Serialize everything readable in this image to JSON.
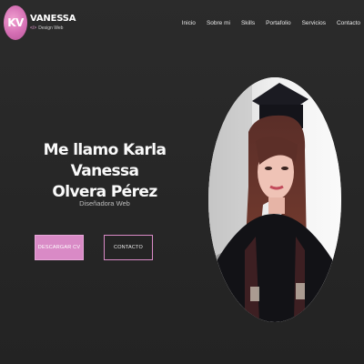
{
  "brand": {
    "logo_text": "KV",
    "name": "VANESSA",
    "code_icon": "</>",
    "tagline": "Design Web"
  },
  "nav": {
    "items": [
      {
        "label": "Inicio"
      },
      {
        "label": "Sobre mi"
      },
      {
        "label": "Skills"
      },
      {
        "label": "Portafolio"
      },
      {
        "label": "Servicios"
      },
      {
        "label": "Contacto"
      }
    ]
  },
  "hero": {
    "title_line1": "Me llamo Karla Vanessa",
    "title_line2": "Olvera Pérez",
    "subtitle": "Diseñadora Web",
    "download_label": "DESCARGAR CV",
    "contact_label": "CONTACTO"
  },
  "colors": {
    "accent": "#d98ac6",
    "background": "#2b2b2b",
    "text": "#f2f2f2"
  },
  "icons": {
    "code": "code-icon"
  }
}
